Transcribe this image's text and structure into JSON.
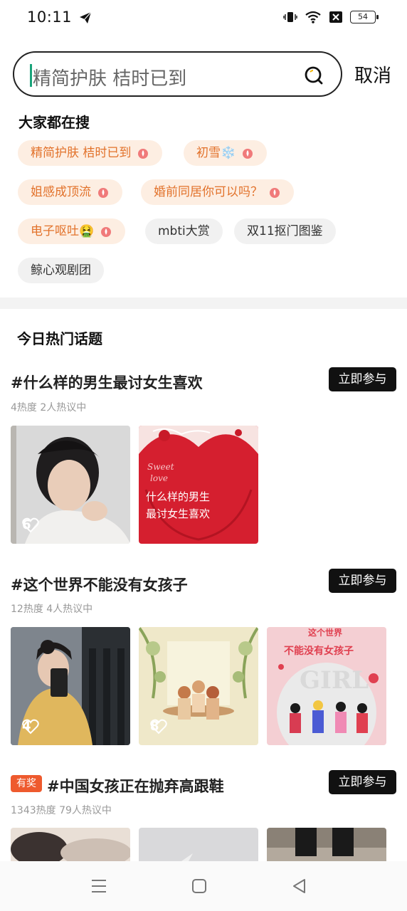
{
  "status_bar": {
    "time": "10:11",
    "battery": "54",
    "icons": [
      "telegram-icon",
      "vibrate-icon",
      "wifi-icon",
      "no-sim-icon",
      "battery-icon"
    ]
  },
  "search": {
    "value": "精简护肤 桔时已到",
    "cancel_label": "取消"
  },
  "trending": {
    "title": "大家都在搜",
    "tags": [
      {
        "label": "精简护肤 桔时已到",
        "hot": true
      },
      {
        "label": "初雪❄️",
        "hot": true
      },
      {
        "label": "姐感成顶流",
        "hot": true
      },
      {
        "label": "婚前同居你可以吗？",
        "hot": true
      },
      {
        "label": "电子呕吐🤮",
        "hot": true
      },
      {
        "label": "mbti大赏",
        "hot": false
      },
      {
        "label": "双11抠门图鉴",
        "hot": false
      },
      {
        "label": "鲸心观剧团",
        "hot": false
      }
    ]
  },
  "hot_topics": {
    "title": "今日热门话题",
    "join_label": "立即参与",
    "award_label": "有奖",
    "topics": [
      {
        "title": "#什么样的男生最讨女生喜欢",
        "meta": "4热度  2人热议中",
        "thumb_likes": [
          "6"
        ],
        "thumb_text": [
          "Sweet",
          "love",
          "什么样的男生",
          "最讨女生喜欢"
        ]
      },
      {
        "title": "#这个世界不能没有女孩子",
        "meta": "12热度  4人热议中",
        "thumb_likes": [
          "4",
          "8"
        ],
        "thumb_text": [
          "这个世界",
          "不能没有女孩子",
          "GIRL"
        ]
      },
      {
        "title": "#中国女孩正在抛弃高跟鞋",
        "meta": "1343热度  79人热议中"
      }
    ]
  },
  "colors": {
    "accent": "#1aa37a",
    "hot_tag_bg": "#fdeee2",
    "hot_tag_text": "#e2722b",
    "award": "#ee5a2e"
  }
}
